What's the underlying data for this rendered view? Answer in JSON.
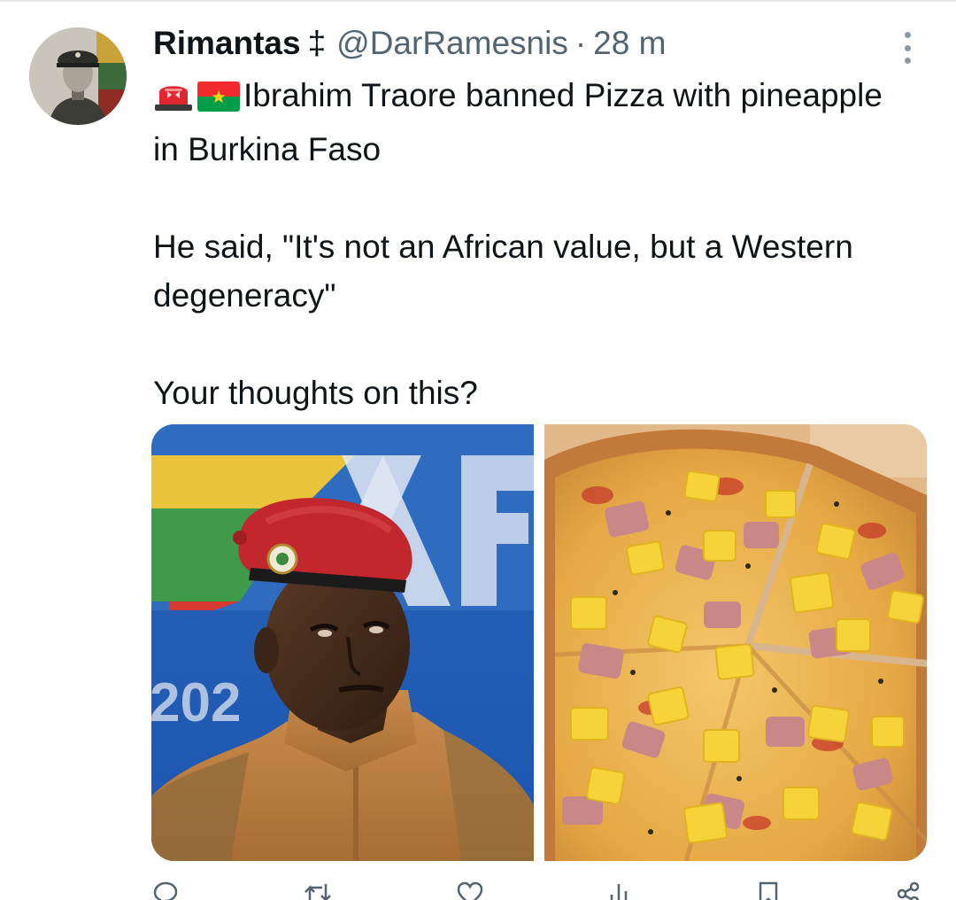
{
  "tweet": {
    "author": {
      "display_name": "Rimantas",
      "name_symbol": "‡",
      "handle": "@DarRamesnis",
      "separator": "·",
      "timestamp": "28 m"
    },
    "text": {
      "line1_emojis": [
        "rotating-light-emoji",
        "burkina-faso-flag-emoji"
      ],
      "paragraph1": "Ibrahim Traore banned Pizza with pineapple in Burkina Faso",
      "paragraph2": "He said, \"It's not an African value, but a Western degeneracy\"",
      "paragraph3": "Your thoughts on this?"
    },
    "media": [
      {
        "description_icon": "soldier-portrait-photo"
      },
      {
        "description_icon": "hawaiian-pizza-photo"
      }
    ],
    "actions": [
      {
        "icon": "reply-icon",
        "count": ""
      },
      {
        "icon": "retweet-icon",
        "count": ""
      },
      {
        "icon": "like-icon",
        "count": ""
      },
      {
        "icon": "views-icon",
        "count": ""
      },
      {
        "icon": "bookmark-icon",
        "count": ""
      },
      {
        "icon": "share-icon",
        "count": ""
      }
    ],
    "colors": {
      "text": "#0f1419",
      "secondary": "#536471",
      "beret": "#c1272d",
      "flag_red": "#ef2b2d",
      "flag_green": "#009e49",
      "flag_star": "#fcd116"
    }
  }
}
